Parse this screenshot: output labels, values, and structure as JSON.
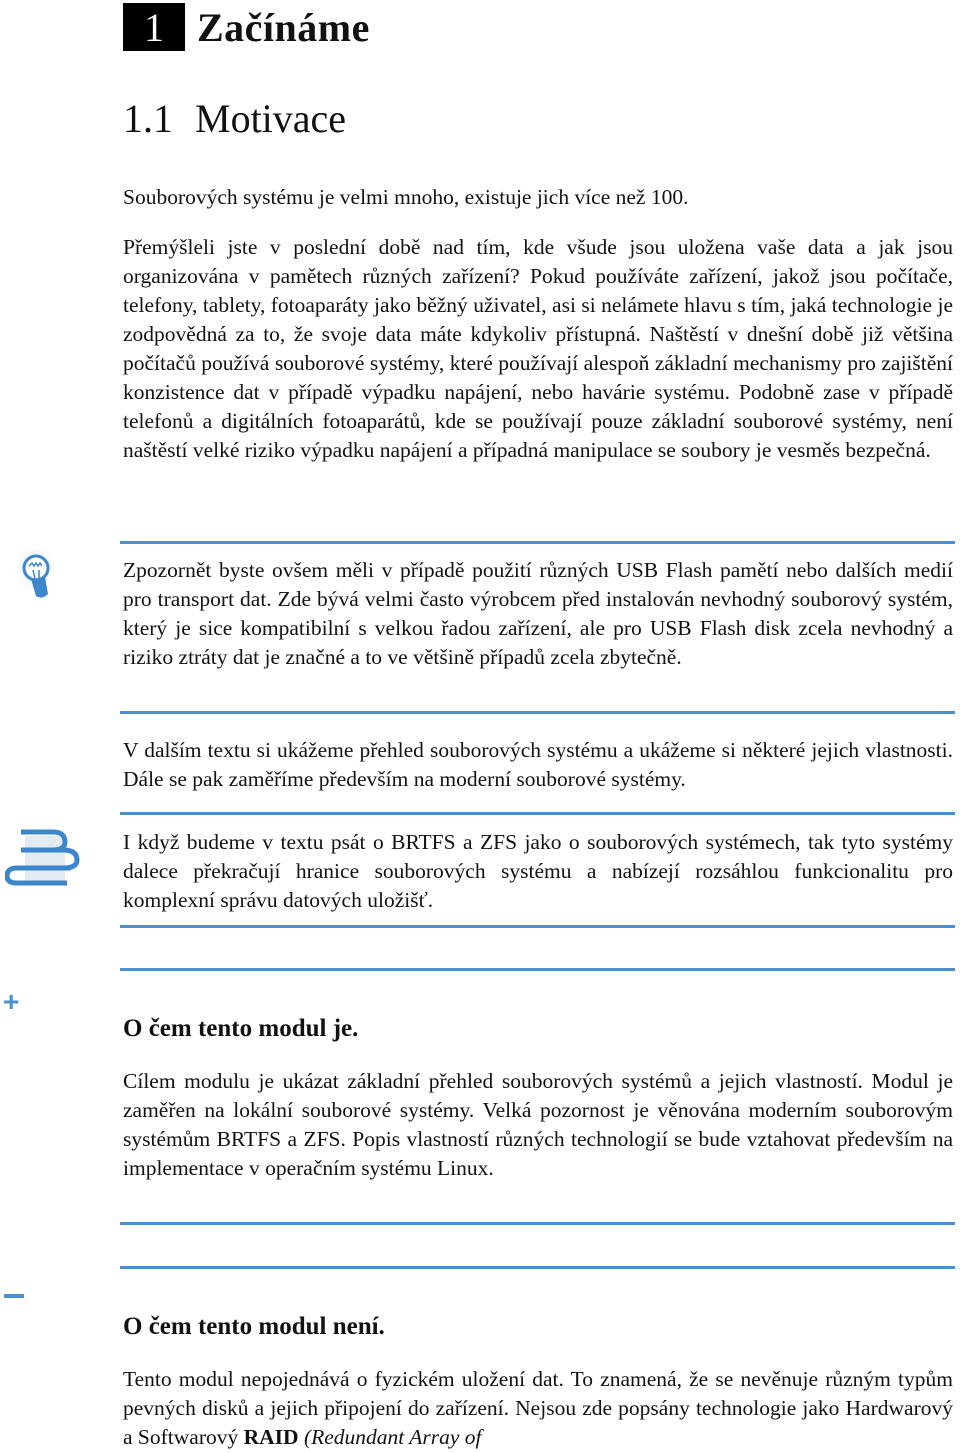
{
  "chapter": {
    "number": "1",
    "title": "Začínáme"
  },
  "section": {
    "number": "1.1",
    "title": "Motivace"
  },
  "paragraphs": {
    "p1": "Souborových systému je velmi mnoho, existuje jich více než 100.",
    "p2": "Přemýšleli jste v poslední době nad tím, kde všude jsou uložena vaše data a jak jsou organizována v pamětech různých zařízení? Pokud používáte zařízení, jakož jsou počítače, telefony, tablety, fotoaparáty jako běžný uživatel, asi si nelámete hlavu s tím, jaká technologie je zodpovědná za to, že svoje data máte kdykoliv přístupná. Naštěstí v dnešní době již většina počítačů používá souborové systémy, které používají alespoň základní mechanismy pro zajištění konzistence dat v případě výpadku napájení, nebo havárie systému. Podobně zase v případě telefonů a digitálních fotoaparátů, kde se používají pouze základní souborové systémy, není naštěstí velké riziko výpadku napájení a případná manipulace se soubory je vesměs bezpečná.",
    "tip": "Zpozornět byste ovšem měli v případě použití různých USB Flash pamětí nebo dalších medií pro transport dat. Zde bývá velmi často výrobcem před instalován nevhodný souborový systém, který je sice kompatibilní s velkou řadou zařízení, ale pro USB Flash disk zcela nevhodný a riziko ztráty dat je značné a to ve většině případů zcela zbytečně.",
    "p3": "V dalším textu si ukážeme přehled souborových systému a ukážeme si některé jejich vlastnosti. Dále se pak zaměříme především na moderní souborové systémy.",
    "note": "I když budeme v textu psát o BRTFS a ZFS jako o souborových systémech, tak tyto systémy dalece překračují hranice souborových systému a nabízejí rozsáhlou funkcionalitu pro komplexní správu datových uložišť."
  },
  "is_box": {
    "marker": "+",
    "title": "O čem tento modul je.",
    "text": "Cílem modulu je ukázat základní přehled souborových systémů a jejich vlastností. Modul je zaměřen na lokální souborové systémy. Velká pozornost je věnována moderním souborovým systémům BRTFS a ZFS. Popis vlastností různých technologií se bude vztahovat především na implementace v operačním systému Linux."
  },
  "isnot_box": {
    "marker": "–",
    "title": "O čem tento modul není.",
    "text_start": "Tento modul nepojednává o fyzickém uložení dat. To znamená, že se nevěnuje různým typům pevných disků a jejich připojení do zařízení. Nejsou zde popsány technologie jako Hardwarový a Softwarový ",
    "text_bold": "RAID",
    "text_italic": " (Redundant Array of"
  },
  "icons": {
    "tip": "lightbulb-icon",
    "note": "books-icon"
  },
  "colors": {
    "accent": "#4a8fcf",
    "text": "#111111"
  }
}
